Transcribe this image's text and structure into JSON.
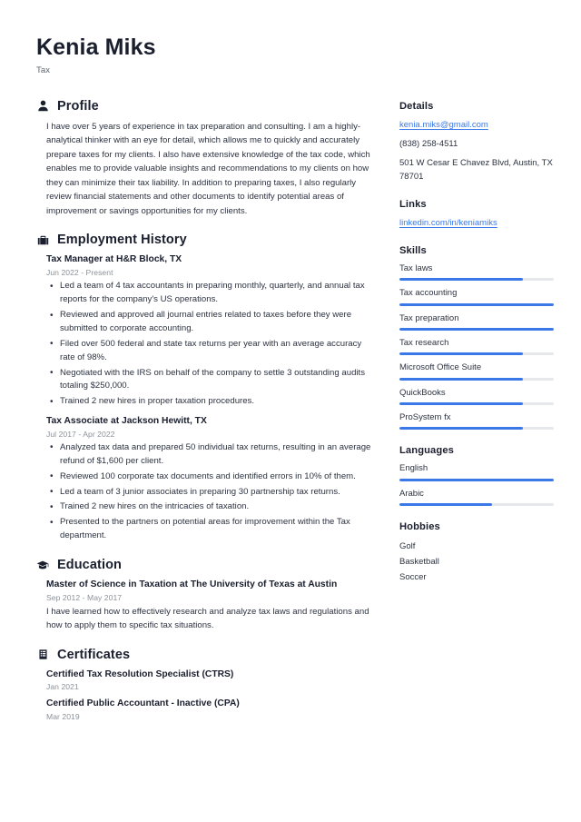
{
  "header": {
    "name": "Kenia Miks",
    "title": "Tax"
  },
  "accent_color": "#3b78e7",
  "text_color": "#2b3240",
  "muted_color": "#8b9199",
  "sections": {
    "profile": {
      "icon": "person-icon",
      "title": "Profile",
      "text": "I have over 5 years of experience in tax preparation and consulting. I am a highly-analytical thinker with an eye for detail, which allows me to quickly and accurately prepare taxes for my clients. I also have extensive knowledge of the tax code, which enables me to provide valuable insights and recommendations to my clients on how they can minimize their tax liability. In addition to preparing taxes, I also regularly review financial statements and other documents to identify potential areas of improvement or savings opportunities for my clients."
    },
    "employment": {
      "icon": "briefcase-icon",
      "title": "Employment History",
      "entries": [
        {
          "title": "Tax Manager at H&R Block, TX",
          "date": "Jun 2022 - Present",
          "bullets": [
            "Led a team of 4 tax accountants in preparing monthly, quarterly, and annual tax reports for the company's US operations.",
            "Reviewed and approved all journal entries related to taxes before they were submitted to corporate accounting.",
            "Filed over 500 federal and state tax returns per year with an average accuracy rate of 98%.",
            "Negotiated with the IRS on behalf of the company to settle 3 outstanding audits totaling $250,000.",
            "Trained 2 new hires in proper taxation procedures."
          ]
        },
        {
          "title": "Tax Associate at Jackson Hewitt, TX",
          "date": "Jul 2017 - Apr 2022",
          "bullets": [
            "Analyzed tax data and prepared 50 individual tax returns, resulting in an average refund of $1,600 per client.",
            "Reviewed 100 corporate tax documents and identified errors in 10% of them.",
            "Led a team of 3 junior associates in preparing 30 partnership tax returns.",
            "Trained 2 new hires on the intricacies of taxation.",
            "Presented to the partners on potential areas for improvement within the Tax department."
          ]
        }
      ]
    },
    "education": {
      "icon": "graduation-cap-icon",
      "title": "Education",
      "entries": [
        {
          "title": "Master of Science in Taxation at The University of Texas at Austin",
          "date": "Sep 2012 - May 2017",
          "description": "I have learned how to effectively research and analyze tax laws and regulations and how to apply them to specific tax situations."
        }
      ]
    },
    "certificates": {
      "icon": "certificate-icon",
      "title": "Certificates",
      "entries": [
        {
          "title": "Certified Tax Resolution Specialist (CTRS)",
          "date": "Jan 2021"
        },
        {
          "title": "Certified Public Accountant - Inactive (CPA)",
          "date": "Mar 2019"
        }
      ]
    }
  },
  "sidebar": {
    "details": {
      "title": "Details",
      "email": "kenia.miks@gmail.com",
      "phone": "(838) 258-4511",
      "address": "501 W Cesar E Chavez Blvd, Austin, TX 78701"
    },
    "links": {
      "title": "Links",
      "items": [
        {
          "label": "linkedin.com/in/keniamiks"
        }
      ]
    },
    "skills": {
      "title": "Skills",
      "items": [
        {
          "label": "Tax laws",
          "level": 80
        },
        {
          "label": "Tax accounting",
          "level": 100
        },
        {
          "label": "Tax preparation",
          "level": 100
        },
        {
          "label": "Tax research",
          "level": 80
        },
        {
          "label": "Microsoft Office Suite",
          "level": 80
        },
        {
          "label": "QuickBooks",
          "level": 80
        },
        {
          "label": "ProSystem fx",
          "level": 80
        }
      ]
    },
    "languages": {
      "title": "Languages",
      "items": [
        {
          "label": "English",
          "level": 100
        },
        {
          "label": "Arabic",
          "level": 60
        }
      ]
    },
    "hobbies": {
      "title": "Hobbies",
      "items": [
        {
          "label": "Golf"
        },
        {
          "label": "Basketball"
        },
        {
          "label": "Soccer"
        }
      ]
    }
  }
}
